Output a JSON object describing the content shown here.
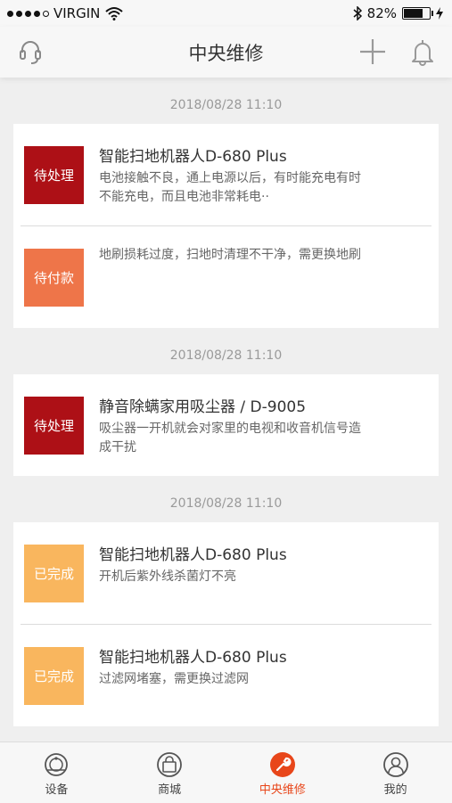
{
  "status_bar": {
    "carrier": "VIRGIN",
    "battery": "82%",
    "battery_level": 0.82
  },
  "nav": {
    "title": "中央维修"
  },
  "groups": [
    {
      "date": "2018/08/28  11:10",
      "orders": [
        {
          "status": "待处理",
          "title": "智能扫地机器人D-680 Plus",
          "desc": "电池接触不良，通上电源以后，有时能充电有时不能充电，而且电池非常耗电··"
        },
        {
          "status": "待付款",
          "title": "",
          "desc": "地刷损耗过度，扫地时清理不干净，需更换地刷"
        }
      ]
    },
    {
      "date": "2018/08/28  11:10",
      "orders": [
        {
          "status": "待处理",
          "title": "静音除螨家用吸尘器 / D-9005",
          "desc": "吸尘器一开机就会对家里的电视和收音机信号造成干扰"
        }
      ]
    },
    {
      "date": "2018/08/28  11:10",
      "orders": [
        {
          "status": "已完成",
          "title": "智能扫地机器人D-680 Plus",
          "desc": "开机后紫外线杀菌灯不亮"
        },
        {
          "status": "已完成",
          "title": "智能扫地机器人D-680 Plus",
          "desc": "过滤网堵塞，需更换过滤网"
        }
      ]
    }
  ],
  "tabs": [
    {
      "label": "设备",
      "icon": "robot-vacuum-icon"
    },
    {
      "label": "商城",
      "icon": "shopping-bag-icon"
    },
    {
      "label": "中央维修",
      "icon": "wrench-icon"
    },
    {
      "label": "我的",
      "icon": "user-icon"
    }
  ],
  "colors": {
    "accent": "#e8461a",
    "pending": "#ad1016",
    "payment": "#ee7549",
    "done": "#f9b65e"
  }
}
